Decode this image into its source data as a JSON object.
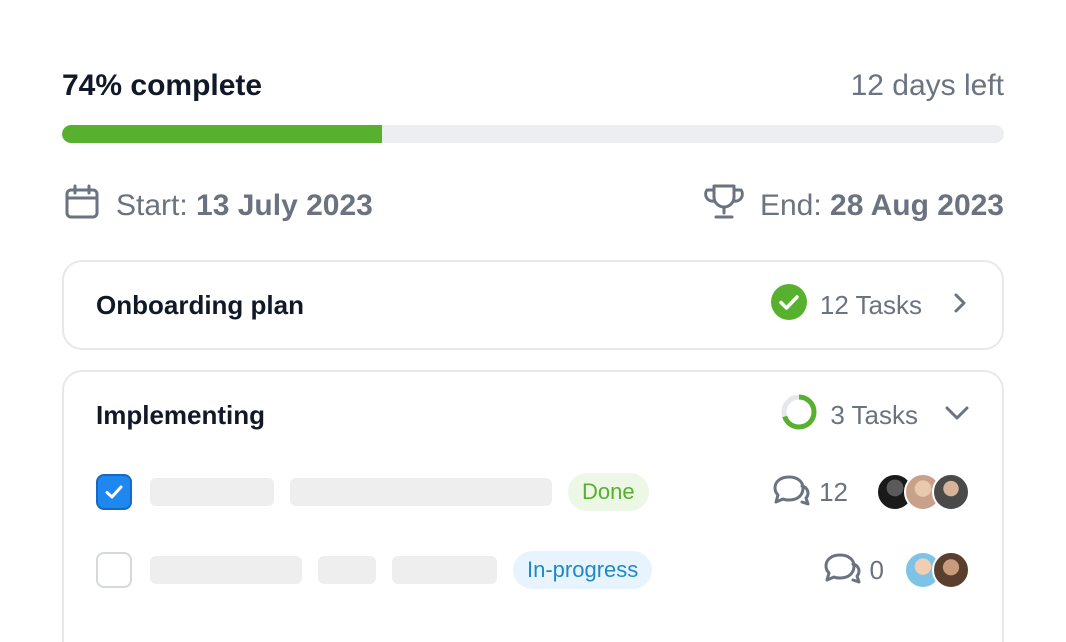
{
  "progress": {
    "percent_label": "74% complete",
    "days_left": "12 days left",
    "fill_percent": 34
  },
  "dates": {
    "start_prefix": "Start:",
    "start_value": "13 July 2023",
    "end_prefix": "End:",
    "end_value": "28 Aug 2023"
  },
  "sections": [
    {
      "title": "Onboarding plan",
      "tasks_label": "12 Tasks",
      "status": "complete",
      "expanded": false
    },
    {
      "title": "Implementing",
      "tasks_label": "3 Tasks",
      "status": "in-progress",
      "expanded": true,
      "tasks": [
        {
          "checked": true,
          "badge": "Done",
          "comments": "12"
        },
        {
          "checked": false,
          "badge": "In-progress",
          "comments": "0"
        }
      ]
    }
  ],
  "colors": {
    "accent_green": "#57b02e",
    "checkbox_blue": "#1e88f0",
    "track": "#eceef1"
  }
}
